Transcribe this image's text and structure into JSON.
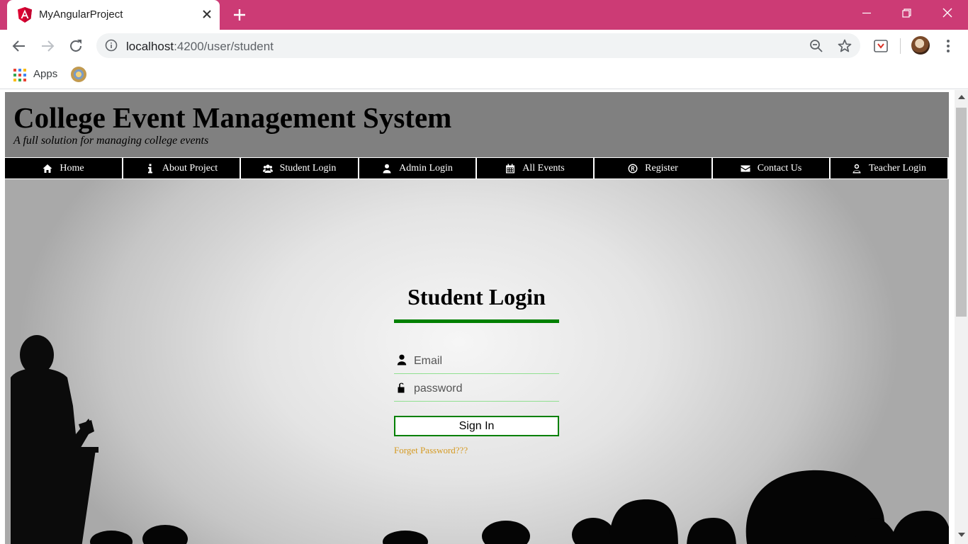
{
  "browser": {
    "tab_title": "MyAngularProject",
    "url_host": "localhost",
    "url_path": ":4200/user/student",
    "bookmarks": [
      {
        "label": "Apps"
      }
    ],
    "colors": {
      "tabstrip": "#cc3b75"
    }
  },
  "site": {
    "title": "College Event Management System",
    "tagline": "A full solution for managing college events"
  },
  "nav": {
    "items": [
      {
        "label": "Home",
        "icon": "home-icon"
      },
      {
        "label": "About Project",
        "icon": "info-icon"
      },
      {
        "label": "Student Login",
        "icon": "users-icon"
      },
      {
        "label": "Admin Login",
        "icon": "user-icon"
      },
      {
        "label": "All Events",
        "icon": "calendar-icon"
      },
      {
        "label": "Register",
        "icon": "registered-icon"
      },
      {
        "label": "Contact Us",
        "icon": "envelope-icon"
      },
      {
        "label": "Teacher Login",
        "icon": "user-outline-icon"
      }
    ]
  },
  "login": {
    "title": "Student Login",
    "email_placeholder": "Email",
    "email_value": "",
    "password_placeholder": "password",
    "password_value": "",
    "signin_label": "Sign In",
    "forgot_label": "Forget Password???",
    "colors": {
      "accent": "#008000",
      "link": "#d59a22"
    }
  }
}
